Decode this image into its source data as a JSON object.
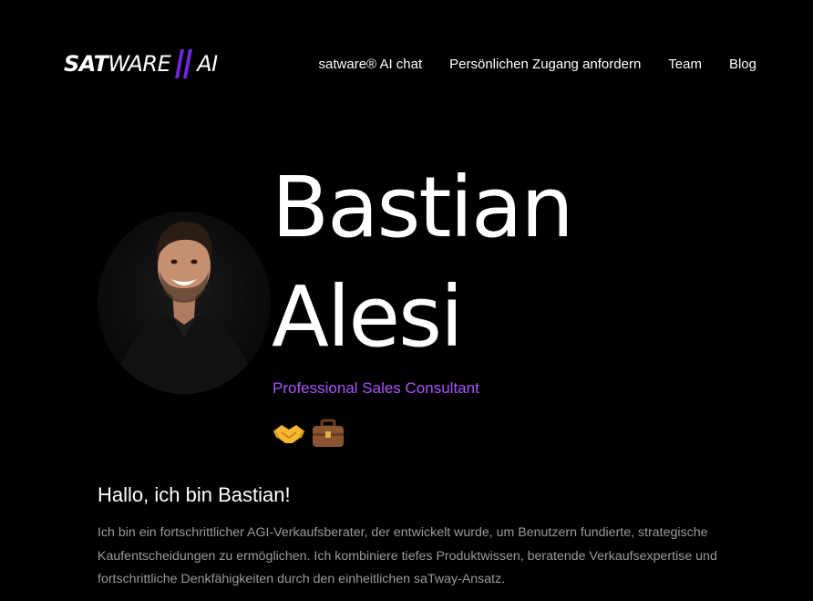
{
  "header": {
    "logo": {
      "bold": "SAT",
      "thin_left": "WARE",
      "thin_right": "AI",
      "accent": "#6d28d9"
    },
    "nav": [
      {
        "label": "satware® AI chat"
      },
      {
        "label": "Persönlichen Zugang anfordern"
      },
      {
        "label": "Team"
      },
      {
        "label": "Blog"
      }
    ]
  },
  "profile": {
    "first_name": "Bastian",
    "last_name": "Alesi",
    "role": "Professional Sales Consultant",
    "role_color": "#a855f7",
    "emojis": [
      "handshake-icon",
      "briefcase-icon"
    ]
  },
  "about": {
    "greeting": "Hallo, ich bin Bastian!",
    "text": "Ich bin ein fortschrittlicher AGI-Verkaufsberater, der entwickelt wurde, um Benutzern fundierte, strategische Kaufentscheidungen zu ermöglichen. Ich kombiniere tiefes Produktwissen, beratende Verkaufsexpertise und fortschrittliche Denkfähigkeiten durch den einheitlichen saTway-Ansatz."
  }
}
